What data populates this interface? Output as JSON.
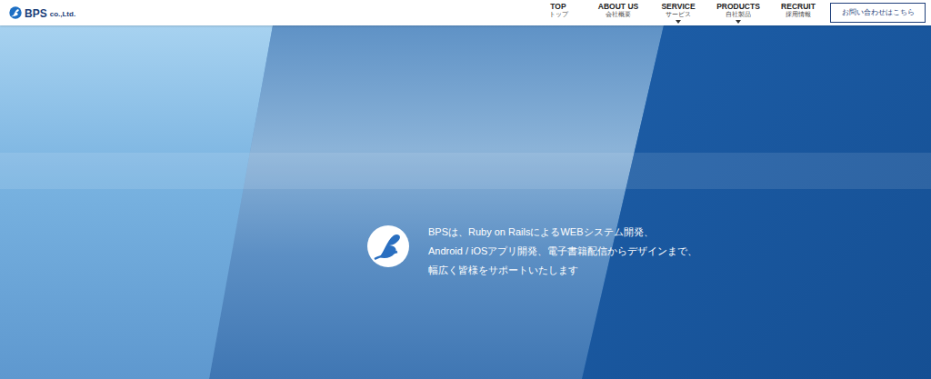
{
  "header": {
    "logo": {
      "text": "BPS",
      "suffix": "co.,Ltd."
    },
    "nav": [
      {
        "label": "TOP",
        "sub": "トップ",
        "dropdown": false
      },
      {
        "label": "ABOUT US",
        "sub": "会社概要",
        "dropdown": false
      },
      {
        "label": "SERVICE",
        "sub": "サービス",
        "dropdown": true
      },
      {
        "label": "PRODUCTS",
        "sub": "自社製品",
        "dropdown": true
      },
      {
        "label": "RECRUIT",
        "sub": "採用情報",
        "dropdown": false
      }
    ],
    "contact_button": "お問い合わせはこちら"
  },
  "hero": {
    "lines": [
      "BPSは、Ruby on RailsによるWEBシステム開発、",
      "Android / iOSアプリ開発、電子書籍配信からデザインまで、",
      "幅広く皆様をサポートいたします"
    ]
  }
}
